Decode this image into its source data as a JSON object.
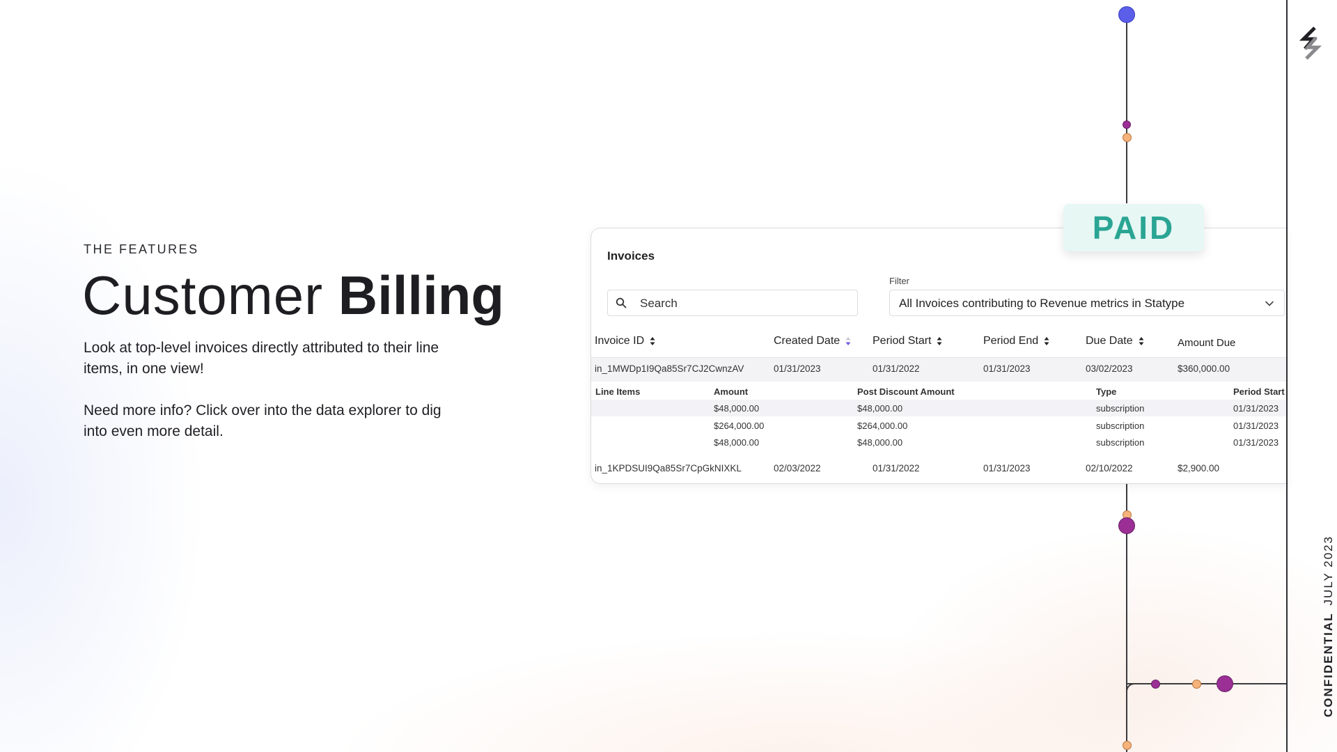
{
  "slide": {
    "eyebrow": "THE FEATURES",
    "title_light": "Customer",
    "title_bold": "Billing",
    "paragraph_1": "Look at top-level invoices directly attributed to their line items, in one view!",
    "paragraph_2": "Need more info? Click over into the data explorer to dig into even more detail."
  },
  "sidebar": {
    "label_strong": "CONFIDENTIAL",
    "label_date": "JULY 2023",
    "logo_icon": "statype-logo-icon"
  },
  "badge": {
    "text": "PAID",
    "color": "#2aa594"
  },
  "invoices": {
    "title": "Invoices",
    "search_placeholder": "Search",
    "filter_label": "Filter",
    "filter_value": "All Invoices contributing to Revenue metrics in Statype",
    "columns": [
      "Invoice ID",
      "Created Date",
      "Period Start",
      "Period End",
      "Due Date",
      "Amount Due"
    ],
    "sorted_column": "Created Date",
    "rows": [
      {
        "id": "in_1MWDp1I9Qa85Sr7CJ2CwnzAV",
        "created": "01/31/2023",
        "period_start": "01/31/2022",
        "period_end": "01/31/2023",
        "due": "03/02/2023",
        "amount": "$360,000.00"
      },
      {
        "id": "in_1KPDSUI9Qa85Sr7CpGkNIXKL",
        "created": "02/03/2022",
        "period_start": "01/31/2022",
        "period_end": "01/31/2023",
        "due": "02/10/2022",
        "amount": "$2,900.00"
      }
    ],
    "line_items": {
      "columns": [
        "Line Items",
        "Amount",
        "Post Discount Amount",
        "Type",
        "Period Start"
      ],
      "rows": [
        {
          "amount": "$48,000.00",
          "post_discount": "$48,000.00",
          "type": "subscription",
          "period_start": "01/31/2023"
        },
        {
          "amount": "$264,000.00",
          "post_discount": "$264,000.00",
          "type": "subscription",
          "period_start": "01/31/2023"
        },
        {
          "amount": "$48,000.00",
          "post_discount": "$48,000.00",
          "type": "subscription",
          "period_start": "01/31/2023"
        }
      ]
    }
  },
  "colors": {
    "accent_blue": "#5a5ee8",
    "accent_purple": "#9b2f96",
    "accent_orange": "#f5b27a"
  }
}
